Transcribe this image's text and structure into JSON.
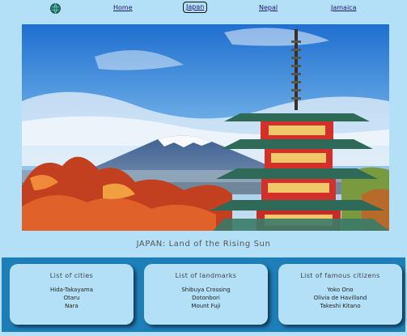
{
  "nav": {
    "items": [
      {
        "label": "Home"
      },
      {
        "label": "Japan",
        "active": true
      },
      {
        "label": "Nepal"
      },
      {
        "label": "Jamaica"
      }
    ],
    "logo_icon": "globe-icon"
  },
  "hero": {
    "image": "photo of Mount Fuji behind a red five-story pagoda with autumn foliage"
  },
  "caption": "JAPAN: Land of the Rising Sun",
  "cards": [
    {
      "title": "List of cities",
      "items": [
        "Hida-Takayama",
        "Otaru",
        "Nara"
      ]
    },
    {
      "title": "List of landmarks",
      "items": [
        "Shibuya Crossing",
        "Dotonbori",
        "Mount Fuji"
      ]
    },
    {
      "title": "List of famous citizens",
      "items": [
        "Yoko Ono",
        "Olivia de Havilland",
        "Takeshi Kitano"
      ]
    }
  ],
  "colors": {
    "background": "#b3e0f7",
    "band": "#1e7fb8",
    "link": "#1a1a66"
  }
}
